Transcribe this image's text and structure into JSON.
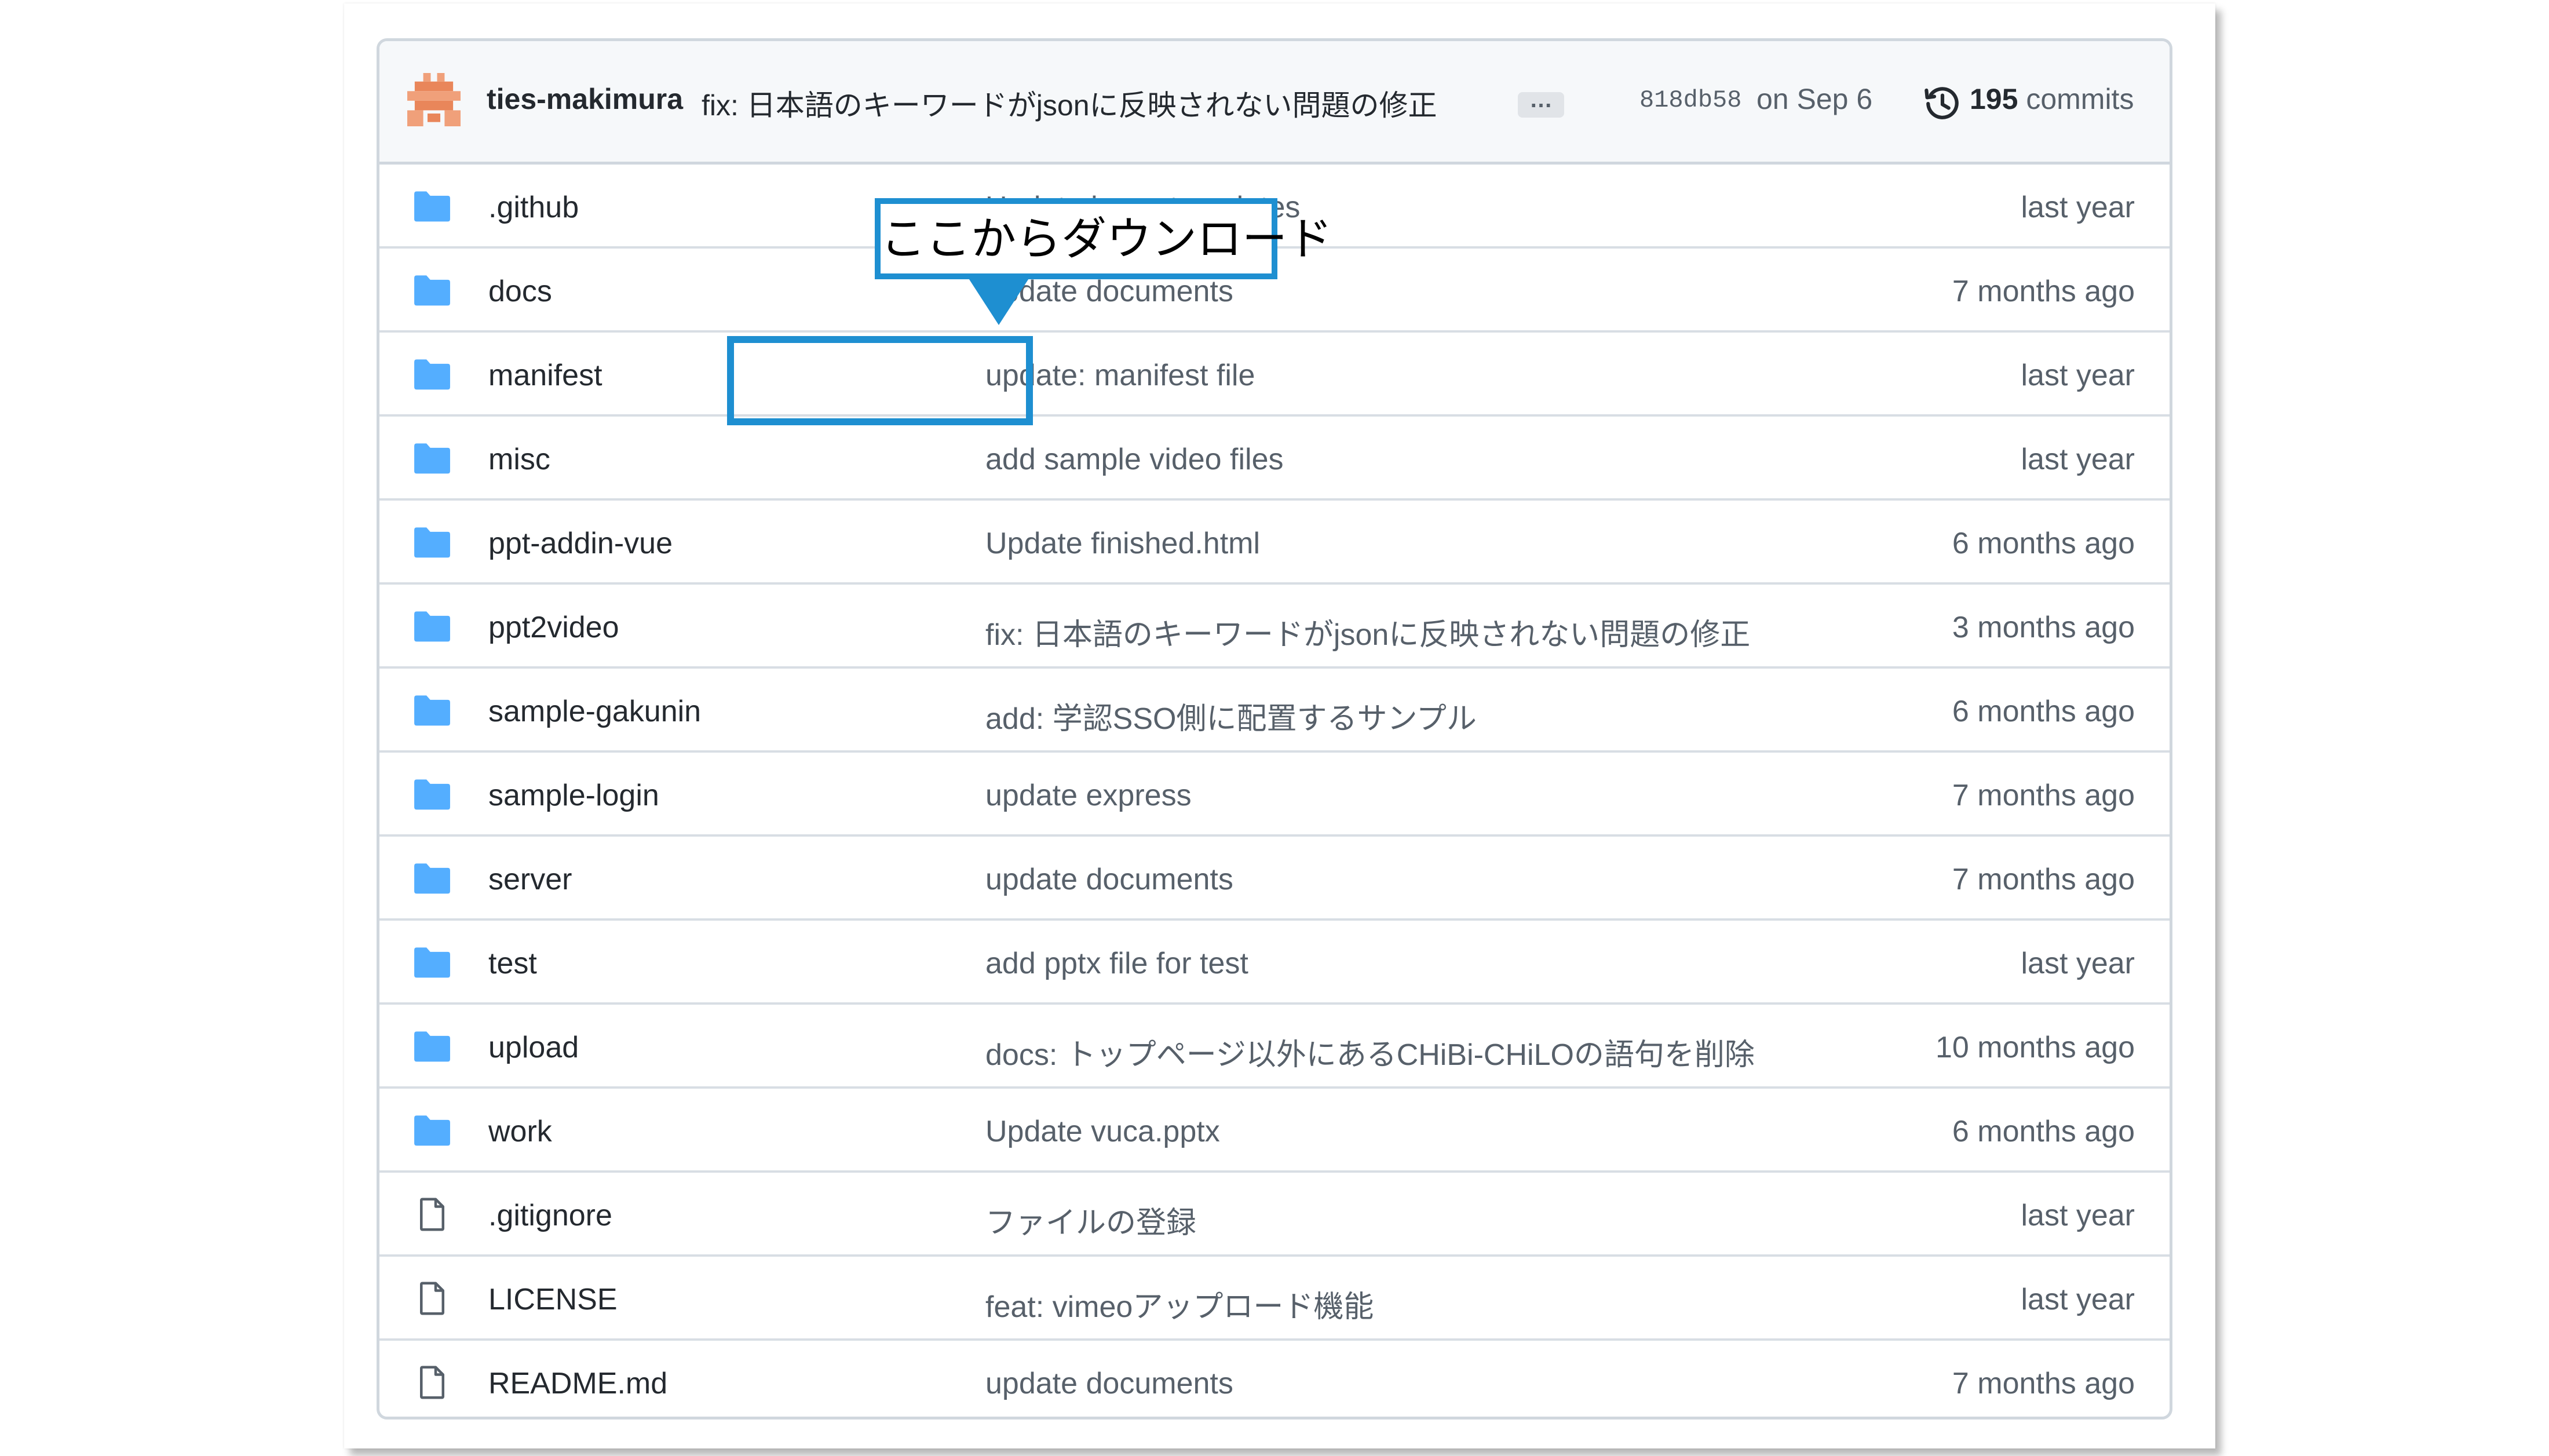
{
  "latest_commit": {
    "author": "ties-makimura",
    "message": "fix: 日本語のキーワードがjsonに反映されない問題の修正",
    "more_label": "…",
    "sha": "818db58",
    "date": "on Sep 6",
    "commit_count": "195",
    "commits_label": "commits"
  },
  "files": [
    {
      "type": "folder",
      "name": ".github",
      "message": "Update issue templates",
      "age": "last year"
    },
    {
      "type": "folder",
      "name": "docs",
      "message": "update documents",
      "age": "7 months ago"
    },
    {
      "type": "folder",
      "name": "manifest",
      "message": "update: manifest file",
      "age": "last year"
    },
    {
      "type": "folder",
      "name": "misc",
      "message": "add sample video files",
      "age": "last year"
    },
    {
      "type": "folder",
      "name": "ppt-addin-vue",
      "message": "Update finished.html",
      "age": "6 months ago"
    },
    {
      "type": "folder",
      "name": "ppt2video",
      "message": "fix: 日本語のキーワードがjsonに反映されない問題の修正",
      "age": "3 months ago"
    },
    {
      "type": "folder",
      "name": "sample-gakunin",
      "message": "add: 学認SSO側に配置するサンプル",
      "age": "6 months ago"
    },
    {
      "type": "folder",
      "name": "sample-login",
      "message": "update express",
      "age": "7 months ago"
    },
    {
      "type": "folder",
      "name": "server",
      "message": "update documents",
      "age": "7 months ago"
    },
    {
      "type": "folder",
      "name": "test",
      "message": "add pptx file for test",
      "age": "last year"
    },
    {
      "type": "folder",
      "name": "upload",
      "message": "docs: トップページ以外にあるCHiBi-CHiLOの語句を削除",
      "age": "10 months ago"
    },
    {
      "type": "folder",
      "name": "work",
      "message": "Update vuca.pptx",
      "age": "6 months ago"
    },
    {
      "type": "file",
      "name": ".gitignore",
      "message": "ファイルの登録",
      "age": "last year"
    },
    {
      "type": "file",
      "name": "LICENSE",
      "message": "feat: vimeoアップロード機能",
      "age": "last year"
    },
    {
      "type": "file",
      "name": "README.md",
      "message": "update documents",
      "age": "7 months ago"
    }
  ],
  "annotation": {
    "callout_text": "ここからダウンロード",
    "highlighted_item": "manifest",
    "color": "#1e8fd1"
  },
  "colors": {
    "folder_icon": "#54aeff",
    "border": "#d0d7de",
    "header_bg": "#f6f8fa"
  }
}
